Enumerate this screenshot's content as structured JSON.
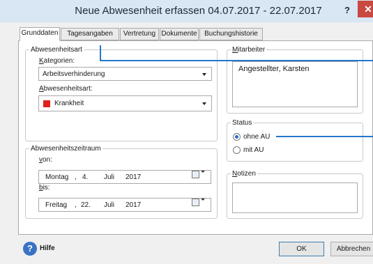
{
  "window": {
    "title": "Neue Abwesenheit erfassen 04.07.2017 - 22.07.2017",
    "help_glyph": "?",
    "close_glyph": "✕"
  },
  "tabs": [
    {
      "label": "Grunddaten",
      "active": true
    },
    {
      "label": "Tagesangaben",
      "active": false
    },
    {
      "label": "Vertretung",
      "active": false
    },
    {
      "label": "Dokumente",
      "active": false
    },
    {
      "label": "Buchungshistorie",
      "active": false
    }
  ],
  "absence_type": {
    "legend": "Abwesenheitsart",
    "category_label_mnemonic": "K",
    "category_label_rest": "ategorien:",
    "category_value": "Arbeitsverhinderung",
    "type_label_mnemonic": "A",
    "type_label_rest": "bwesenheitsart:",
    "type_value": "Krankheit",
    "type_color": "#e02020"
  },
  "period": {
    "legend": "Abwesenheitszeitraum",
    "from_label_mnemonic": "v",
    "from_label_rest": "on:",
    "from": {
      "weekday": "Montag",
      "day": "4.",
      "month": "Juli",
      "year": "2017"
    },
    "to_label_mnemonic": "b",
    "to_label_rest": "is:",
    "to": {
      "weekday": "Freitag",
      "day": "22.",
      "month": "Juli",
      "year": "2017"
    },
    "separator": ","
  },
  "employee": {
    "legend_mnemonic": "M",
    "legend_rest": "itarbeiter",
    "name": "Angestellter, Karsten"
  },
  "status": {
    "legend": "Status",
    "options": [
      {
        "label": "ohne AU",
        "selected": true
      },
      {
        "label": "mit AU",
        "selected": false
      }
    ]
  },
  "notes": {
    "legend_mnemonic": "N",
    "legend_rest": "otizen"
  },
  "footer": {
    "help_label": "Hilfe",
    "help_glyph": "?",
    "ok_label": "OK",
    "cancel_label": "Abbrechen"
  },
  "colors": {
    "callout": "#2677c9",
    "titlebar": "#d9e6f4",
    "close": "#c9483f"
  }
}
